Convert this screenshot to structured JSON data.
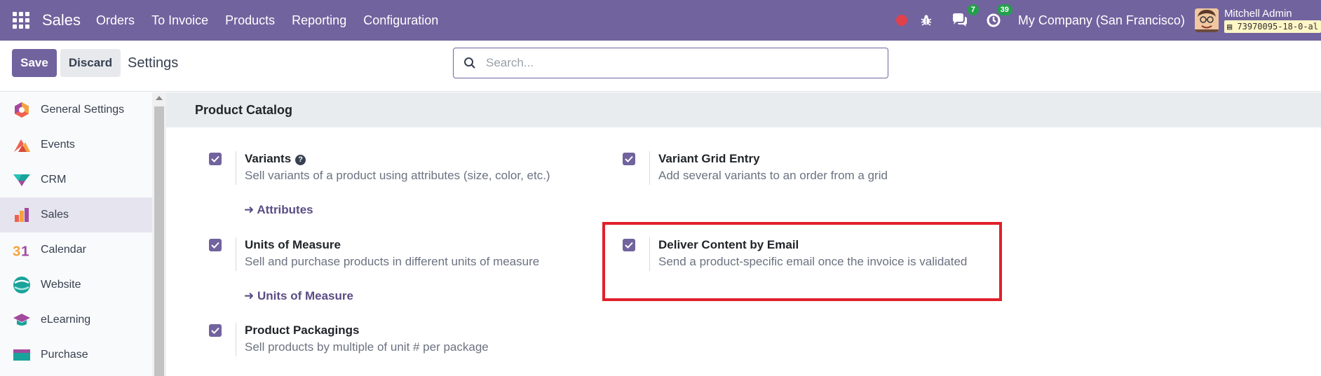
{
  "navbar": {
    "brand": "Sales",
    "menu": [
      "Orders",
      "To Invoice",
      "Products",
      "Reporting",
      "Configuration"
    ],
    "messages_count": "7",
    "activities_count": "39",
    "company": "My Company (San Francisco)",
    "user_name": "Mitchell Admin",
    "database": "73970095-18-0-al"
  },
  "controlbar": {
    "save_label": "Save",
    "discard_label": "Discard",
    "title": "Settings",
    "search_placeholder": "Search..."
  },
  "sidebar": {
    "items": [
      {
        "label": "General Settings",
        "icon": "general-settings-icon"
      },
      {
        "label": "Events",
        "icon": "events-icon"
      },
      {
        "label": "CRM",
        "icon": "crm-icon"
      },
      {
        "label": "Sales",
        "icon": "sales-icon",
        "active": true
      },
      {
        "label": "Calendar",
        "icon": "calendar-icon"
      },
      {
        "label": "Website",
        "icon": "website-icon"
      },
      {
        "label": "eLearning",
        "icon": "elearning-icon"
      },
      {
        "label": "Purchase",
        "icon": "purchase-icon"
      }
    ]
  },
  "section": {
    "title": "Product Catalog",
    "settings": [
      {
        "title": "Variants",
        "desc": "Sell variants of a product using attributes (size, color, etc.)",
        "link": "Attributes",
        "checked": true
      },
      {
        "title": "Variant Grid Entry",
        "desc": "Add several variants to an order from a grid",
        "checked": true
      },
      {
        "title": "Units of Measure",
        "desc": "Sell and purchase products in different units of measure",
        "link": "Units of Measure",
        "checked": true
      },
      {
        "title": "Deliver Content by Email",
        "desc": "Send a product-specific email once the invoice is validated",
        "checked": true
      },
      {
        "title": "Product Packagings",
        "desc": "Sell products by multiple of unit # per package",
        "checked": true
      }
    ]
  },
  "colors": {
    "brand": "#71639e",
    "highlight": "#e0202a",
    "badge": "#22a04b"
  }
}
